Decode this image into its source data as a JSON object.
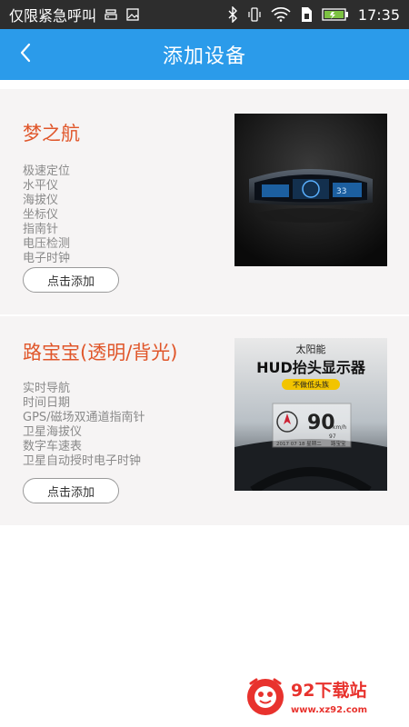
{
  "status_bar": {
    "carrier": "仅限紧急呼叫",
    "time": "17:35",
    "icons": [
      "storage-icon",
      "image-icon",
      "bluetooth-icon",
      "vibrate-icon",
      "wifi-icon",
      "sim-icon",
      "battery-icon"
    ]
  },
  "header": {
    "title": "添加设备",
    "back_icon": "chevron-left-icon"
  },
  "devices": [
    {
      "name": "梦之航",
      "features": [
        "极速定位",
        "水平仪",
        "海拔仪",
        "坐标仪",
        "指南针",
        "电压检测",
        "电子时钟"
      ],
      "button_label": "点击添加",
      "image": "dashboard-gauge-device-photo"
    },
    {
      "name": "路宝宝(透明/背光)",
      "features": [
        "实时导航",
        "时间日期",
        "GPS/磁场双通道指南针",
        "卫星海拔仪",
        "数字车速表",
        "卫星自动授时电子时钟"
      ],
      "button_label": "点击添加",
      "image": "hud-product-photo",
      "image_texts": {
        "top": "太阳能",
        "headline": "HUD抬头显示器",
        "tag": "不做低头族",
        "speed": "90",
        "speed_unit": "km/h",
        "date": "2017 07 18 星期二",
        "temp": "97",
        "brand": "路宝宝"
      }
    }
  ],
  "watermark": {
    "name": "92下载站",
    "url": "www.xz92.com"
  },
  "colors": {
    "status_bar": "#2d2d2d",
    "app_bar": "#2b9bea",
    "title_accent": "#e0562a",
    "card_bg": "#f6f4f4",
    "feature_text": "#8a8a8a",
    "watermark_red": "#e8322d"
  }
}
